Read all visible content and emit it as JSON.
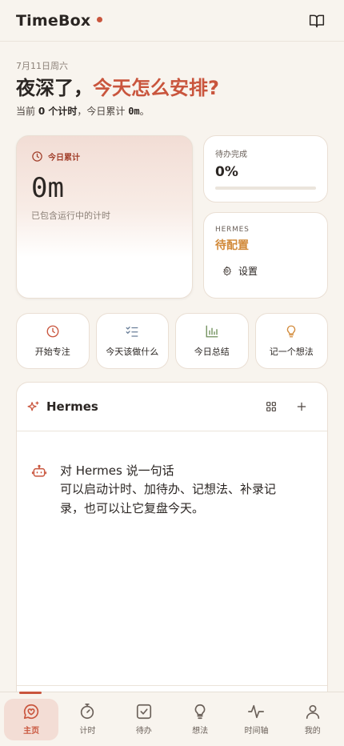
{
  "header": {
    "app_title": "TimeBox",
    "book_icon": "book-open-icon"
  },
  "greeting": {
    "date": "7月11日周六",
    "headline_prefix": "夜深了，",
    "headline_accent": "今天怎么安排?",
    "sub_pre": "当前 ",
    "sub_count": "0 个计时",
    "sub_mid": "，今日累计 ",
    "sub_total": "0m",
    "sub_end": "。"
  },
  "today_card": {
    "label": "今日累计",
    "value": "0m",
    "note": "已包含运行中的计时"
  },
  "todo_card": {
    "label": "待办完成",
    "value": "0%",
    "progress": 0
  },
  "hermes_card": {
    "label": "HERMES",
    "status": "待配置",
    "settings_label": "设置"
  },
  "quick_actions": [
    {
      "label": "开始专注",
      "icon": "clock-icon"
    },
    {
      "label": "今天该做什么",
      "icon": "checklist-icon"
    },
    {
      "label": "今日总结",
      "icon": "bar-chart-icon"
    },
    {
      "label": "记一个想法",
      "icon": "lightbulb-icon"
    }
  ],
  "hermes_panel": {
    "title": "Hermes",
    "message_title": "对 Hermes 说一句话",
    "message_body": "可以启动计时、加待办、记想法、补录记录，也可以让它复盘今天。"
  },
  "tabs": [
    {
      "label": "主页",
      "icon": "home-heart-icon",
      "active": true
    },
    {
      "label": "计时",
      "icon": "stopwatch-icon",
      "active": false
    },
    {
      "label": "待办",
      "icon": "checkbox-icon",
      "active": false
    },
    {
      "label": "想法",
      "icon": "lightbulb-icon",
      "active": false
    },
    {
      "label": "时间轴",
      "icon": "pulse-icon",
      "active": false
    },
    {
      "label": "我的",
      "icon": "user-icon",
      "active": false
    }
  ],
  "colors": {
    "accent": "#c9553d",
    "warning": "#d28a3a",
    "background": "#f8f4ee"
  }
}
